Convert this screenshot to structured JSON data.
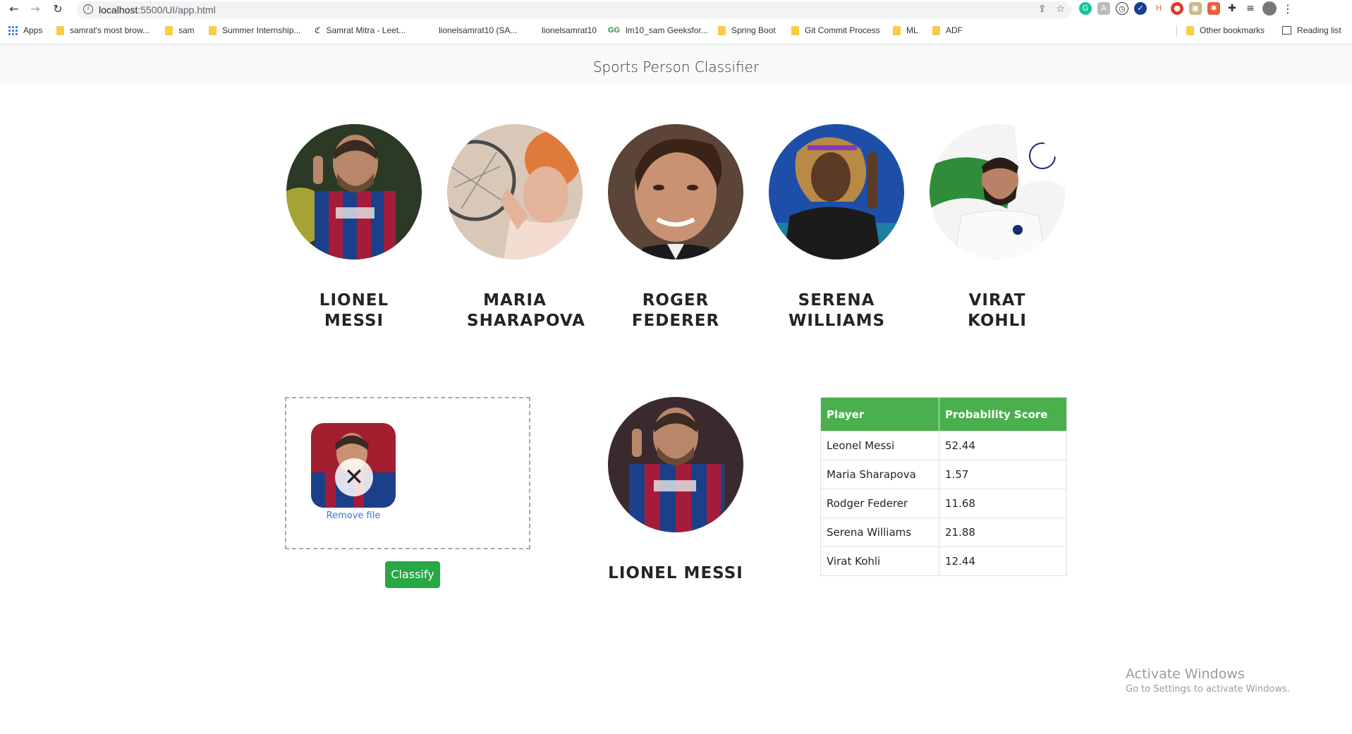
{
  "browser": {
    "url_host": "localhost",
    "url_path": ":5500/UI/app.html",
    "bookmarks": [
      {
        "label": "Apps",
        "icon": "apps-grid-icon"
      },
      {
        "label": "samrat's most brow...",
        "icon": "folder-icon"
      },
      {
        "label": "sam",
        "icon": "folder-icon"
      },
      {
        "label": "Summer Internship...",
        "icon": "folder-icon"
      },
      {
        "label": "Samrat Mitra - Leet...",
        "icon": "leetcode-icon"
      },
      {
        "label": "lionelsamrat10 (SA...",
        "icon": "site-icon"
      },
      {
        "label": "lionelsamrat10",
        "icon": "site-icon"
      },
      {
        "label": "lm10_sam Geeksfor...",
        "icon": "geeksforgeeks-icon"
      },
      {
        "label": "Spring Boot",
        "icon": "folder-icon"
      },
      {
        "label": "Git Commit Process",
        "icon": "folder-icon"
      },
      {
        "label": "ML",
        "icon": "folder-icon"
      },
      {
        "label": "ADF",
        "icon": "folder-icon"
      }
    ],
    "other_bookmarks": "Other bookmarks",
    "reading_list": "Reading list"
  },
  "header": {
    "title": "Sports Person Classifier"
  },
  "players": [
    {
      "name": "LIONEL MESSI"
    },
    {
      "name": "MARIA SHARAPOVA"
    },
    {
      "name": "ROGER FEDERER"
    },
    {
      "name": "SERENA WILLIAMS"
    },
    {
      "name": "VIRAT KOHLI"
    }
  ],
  "upload": {
    "remove_label": "Remove file",
    "classify_label": "Classify"
  },
  "result": {
    "name": "LIONEL MESSI"
  },
  "scores": {
    "headers": [
      "Player",
      "Probability Score"
    ],
    "rows": [
      {
        "player": "Leonel Messi",
        "score": "52.44"
      },
      {
        "player": "Maria Sharapova",
        "score": "1.57"
      },
      {
        "player": "Rodger Federer",
        "score": "11.68"
      },
      {
        "player": "Serena Williams",
        "score": "21.88"
      },
      {
        "player": "Virat Kohli",
        "score": "12.44"
      }
    ]
  },
  "watermark": {
    "line1": "Activate Windows",
    "line2": "Go to Settings to activate Windows."
  },
  "colors": {
    "accent_green": "#28a745",
    "table_header_green": "#4ab04d",
    "link_blue": "#2f7bd8"
  }
}
